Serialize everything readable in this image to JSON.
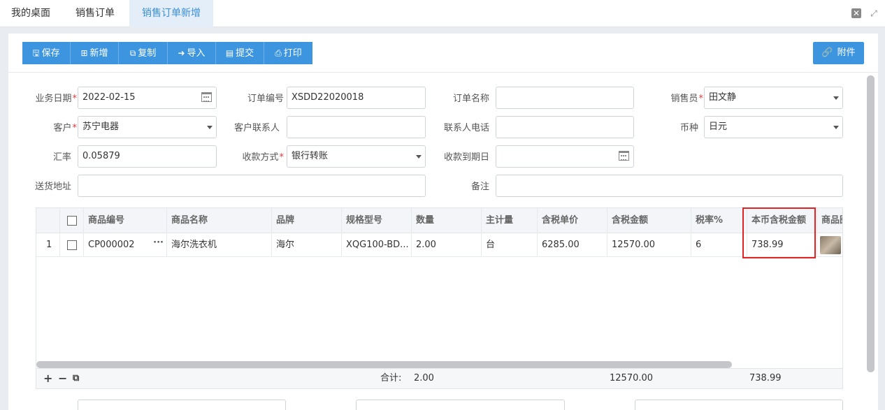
{
  "tabs": [
    {
      "label": "我的桌面",
      "active": false
    },
    {
      "label": "销售订单",
      "active": false
    },
    {
      "label": "销售订单新增",
      "active": true
    }
  ],
  "toolbar": {
    "buttons": [
      {
        "label": "保存",
        "icon": "save-icon",
        "glyph": "🖫"
      },
      {
        "label": "新增",
        "icon": "add-icon",
        "glyph": "⊞"
      },
      {
        "label": "复制",
        "icon": "copy-icon",
        "glyph": "⧉"
      },
      {
        "label": "导入",
        "icon": "import-icon",
        "glyph": "➜"
      },
      {
        "label": "提交",
        "icon": "submit-icon",
        "glyph": "▤"
      },
      {
        "label": "打印",
        "icon": "print-icon",
        "glyph": "⎙"
      }
    ],
    "attach_label": "附件"
  },
  "form": {
    "biz_date": {
      "label": "业务日期",
      "value": "2022-02-15"
    },
    "order_no": {
      "label": "订单编号",
      "value": "XSDD22020018"
    },
    "order_name": {
      "label": "订单名称",
      "value": ""
    },
    "salesman": {
      "label": "销售员",
      "value": "田文静"
    },
    "customer": {
      "label": "客户",
      "value": "苏宁电器"
    },
    "contact": {
      "label": "客户联系人",
      "value": ""
    },
    "contact_phone": {
      "label": "联系人电话",
      "value": ""
    },
    "currency": {
      "label": "币种",
      "value": "日元"
    },
    "rate": {
      "label": "汇率",
      "value": "0.05879"
    },
    "pay_method": {
      "label": "收款方式",
      "value": "银行转账"
    },
    "due_date": {
      "label": "收款到期日",
      "value": ""
    },
    "address": {
      "label": "送货地址",
      "value": ""
    },
    "remark": {
      "label": "备注",
      "value": ""
    }
  },
  "grid": {
    "columns": [
      "商品编号",
      "商品名称",
      "品牌",
      "规格型号",
      "数量",
      "主计量",
      "含税单价",
      "含税金额",
      "税率%",
      "本币含税金额",
      "商品图片"
    ],
    "rows": [
      {
        "index": "1",
        "code": "CP000002",
        "name": "海尔洗衣机",
        "brand": "海尔",
        "spec": "XQG100-BD...",
        "qty": "2.00",
        "unit": "台",
        "price": "6285.00",
        "amount": "12570.00",
        "tax": "6",
        "local_amount": "738.99"
      }
    ],
    "footer": {
      "total_label": "合计:",
      "qty": "2.00",
      "amount": "12570.00",
      "local_amount": "738.99"
    }
  },
  "colors": {
    "primary": "#3c95de",
    "highlight": "#e02424",
    "active_tab": "#3b8fd6"
  }
}
